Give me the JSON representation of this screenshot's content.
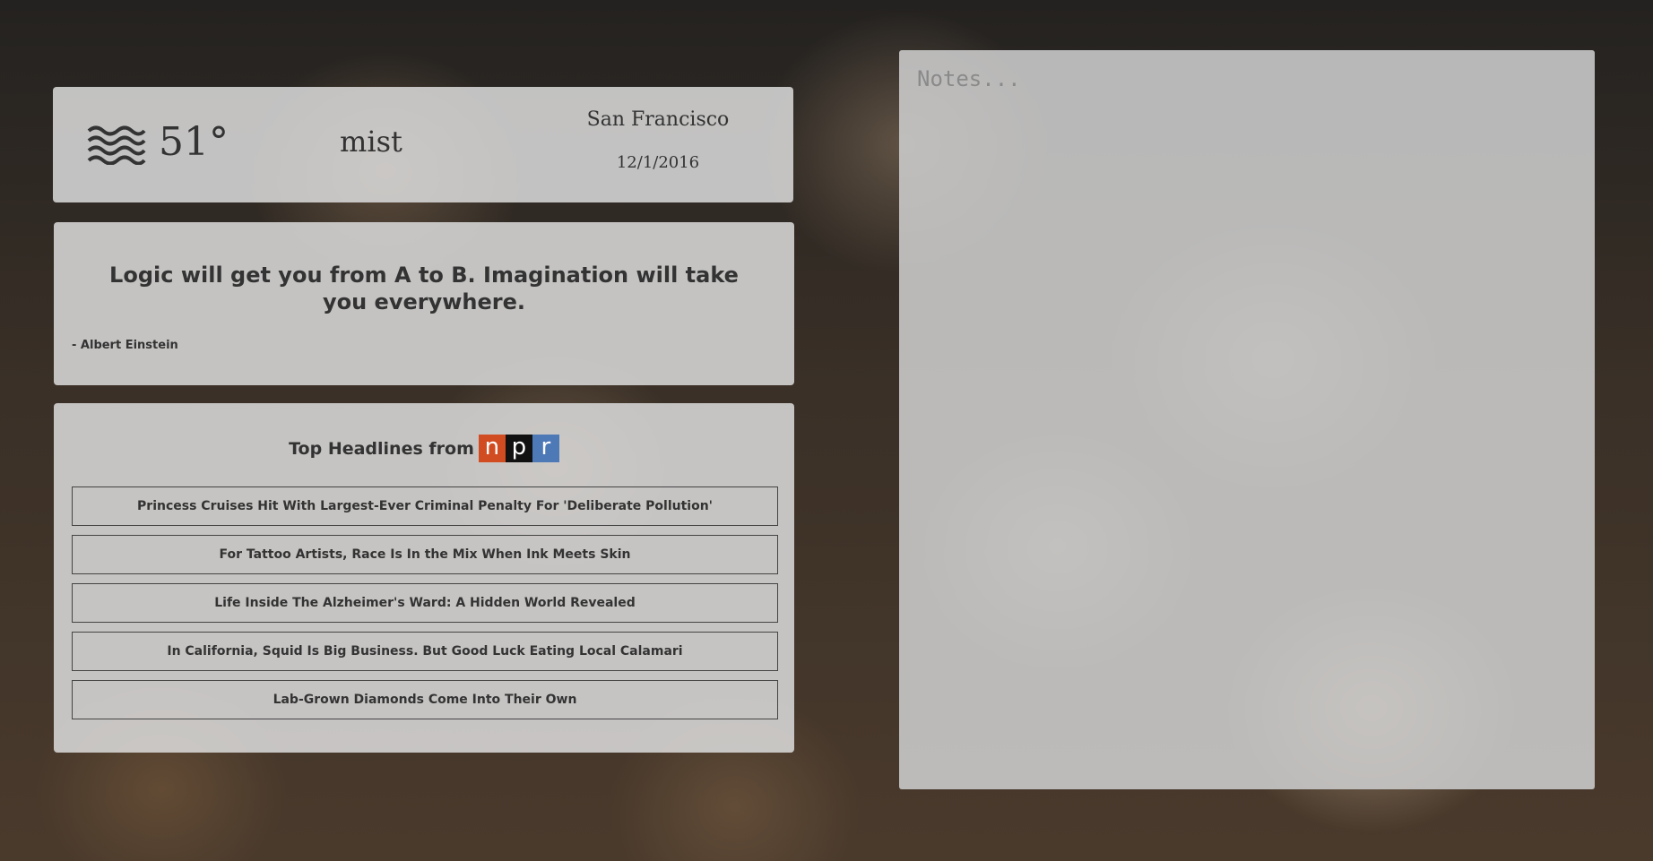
{
  "weather": {
    "icon": "mist-waves-icon",
    "temperature": "51°",
    "condition": "mist",
    "city": "San Francisco",
    "date": "12/1/2016"
  },
  "quote": {
    "text": "Logic will get you from A to B. Imagination will take you everywhere.",
    "author": "- Albert Einstein"
  },
  "news": {
    "title": "Top Headlines from",
    "logo": {
      "n": "n",
      "p": "p",
      "r": "r"
    },
    "headlines": [
      "Princess Cruises Hit With Largest-Ever Criminal Penalty For 'Deliberate Pollution'",
      "For Tattoo Artists, Race Is In the Mix When Ink Meets Skin",
      "Life Inside The Alzheimer's Ward: A Hidden World Revealed",
      "In California, Squid Is Big Business. But Good Luck Eating Local Calamari",
      "Lab-Grown Diamonds Come Into Their Own"
    ]
  },
  "notes": {
    "placeholder": "Notes...",
    "value": ""
  },
  "colors": {
    "npr_n": "#d14d21",
    "npr_p": "#111111",
    "npr_r": "#4e79b7",
    "panel": "#dcdcdc",
    "text": "#333333"
  }
}
